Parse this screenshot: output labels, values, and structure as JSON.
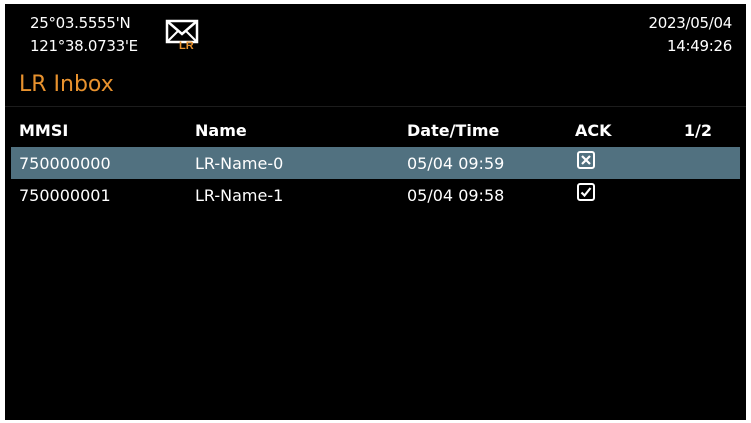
{
  "status": {
    "latitude": "25°03.5555'N",
    "longitude": "121°38.0733'E",
    "date": "2023/05/04",
    "time": "14:49:26",
    "icon": "lr-envelope-icon",
    "icon_badge": "LR"
  },
  "page": {
    "title": "LR Inbox",
    "accent_color": "#e8922e",
    "selection_color": "#517180"
  },
  "table": {
    "headers": {
      "mmsi": "MMSI",
      "name": "Name",
      "datetime": "Date/Time",
      "ack": "ACK",
      "page": "1/2"
    },
    "rows": [
      {
        "mmsi": "750000000",
        "name": "LR-Name-0",
        "datetime": "05/04 09:59",
        "ack": "x-mark-icon",
        "selected": true
      },
      {
        "mmsi": "750000001",
        "name": "LR-Name-1",
        "datetime": "05/04 09:58",
        "ack": "check-mark-icon",
        "selected": false
      }
    ]
  }
}
